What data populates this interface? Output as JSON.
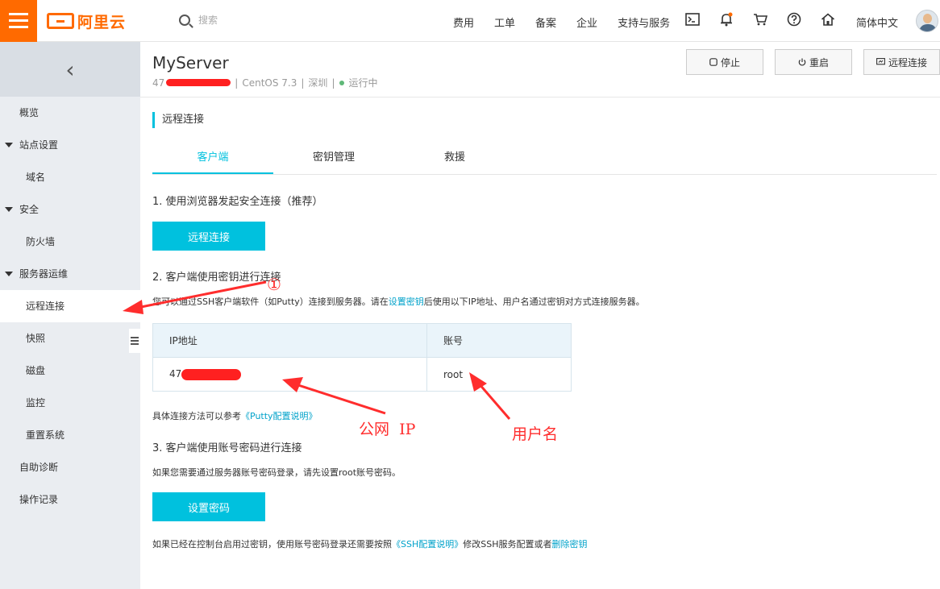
{
  "topbar": {
    "logo_text": "阿里云",
    "search_placeholder": "搜索",
    "nav": [
      "费用",
      "工单",
      "备案",
      "企业",
      "支持与服务"
    ],
    "icons": [
      "terminal-icon",
      "bell-icon",
      "cart-icon",
      "help-icon",
      "home-icon"
    ],
    "language": "简体中文",
    "brand_color": "#ff6a00"
  },
  "sidebar": {
    "collapse_icon": "chevron-left-icon",
    "items": [
      {
        "label": "概览",
        "level": 1,
        "expandable": false
      },
      {
        "label": "站点设置",
        "level": 1,
        "expandable": true
      },
      {
        "label": "域名",
        "level": 2,
        "expandable": false
      },
      {
        "label": "安全",
        "level": 1,
        "expandable": true
      },
      {
        "label": "防火墙",
        "level": 2,
        "expandable": false
      },
      {
        "label": "服务器运维",
        "level": 1,
        "expandable": true
      },
      {
        "label": "远程连接",
        "level": 2,
        "expandable": false,
        "active": true
      },
      {
        "label": "快照",
        "level": 2,
        "expandable": false
      },
      {
        "label": "磁盘",
        "level": 2,
        "expandable": false
      },
      {
        "label": "监控",
        "level": 2,
        "expandable": false
      },
      {
        "label": "重置系统",
        "level": 2,
        "expandable": false
      },
      {
        "label": "自助诊断",
        "level": 1,
        "expandable": false
      },
      {
        "label": "操作记录",
        "level": 1,
        "expandable": false
      }
    ]
  },
  "server": {
    "name": "MyServer",
    "ip_prefix": "47",
    "os": "CentOS 7.3",
    "region": "深圳",
    "status": "运行中",
    "status_color": "#5fb878"
  },
  "actions": {
    "stop": "停止",
    "restart": "重启",
    "remote": "远程连接"
  },
  "main": {
    "section_title": "远程连接",
    "tabs": [
      "客户端",
      "密钥管理",
      "救援"
    ],
    "accent_color": "#00c1de",
    "step1": "1. 使用浏览器发起安全连接（推荐）",
    "step1_button": "远程连接",
    "step2": "2. 客户端使用密钥进行连接",
    "step2_desc_a": "您可以通过SSH客户端软件（如Putty）连接到服务器。请在",
    "step2_desc_link": "设置密钥",
    "step2_desc_b": "后使用以下IP地址、用户名通过密钥对方式连接服务器。",
    "table_headers": [
      "IP地址",
      "账号"
    ],
    "table_ip_prefix": "47",
    "table_account": "root",
    "putty_text": "具体连接方法可以参考",
    "putty_link": "《Putty配置说明》",
    "step3": "3. 客户端使用账号密码进行连接",
    "step3_desc": "如果您需要通过服务器账号密码登录，请先设置root账号密码。",
    "step3_button": "设置密码",
    "footer_a": "如果已经在控制台启用过密钥，使用账号密码登录还需要按照",
    "footer_link1": "《SSH配置说明》",
    "footer_b": "修改SSH服务配置或者",
    "footer_link2": "删除密钥"
  },
  "annotations": {
    "marker": "①",
    "public_ip": "公网  IP",
    "username": "用户名",
    "color": "#ff2d2d"
  }
}
